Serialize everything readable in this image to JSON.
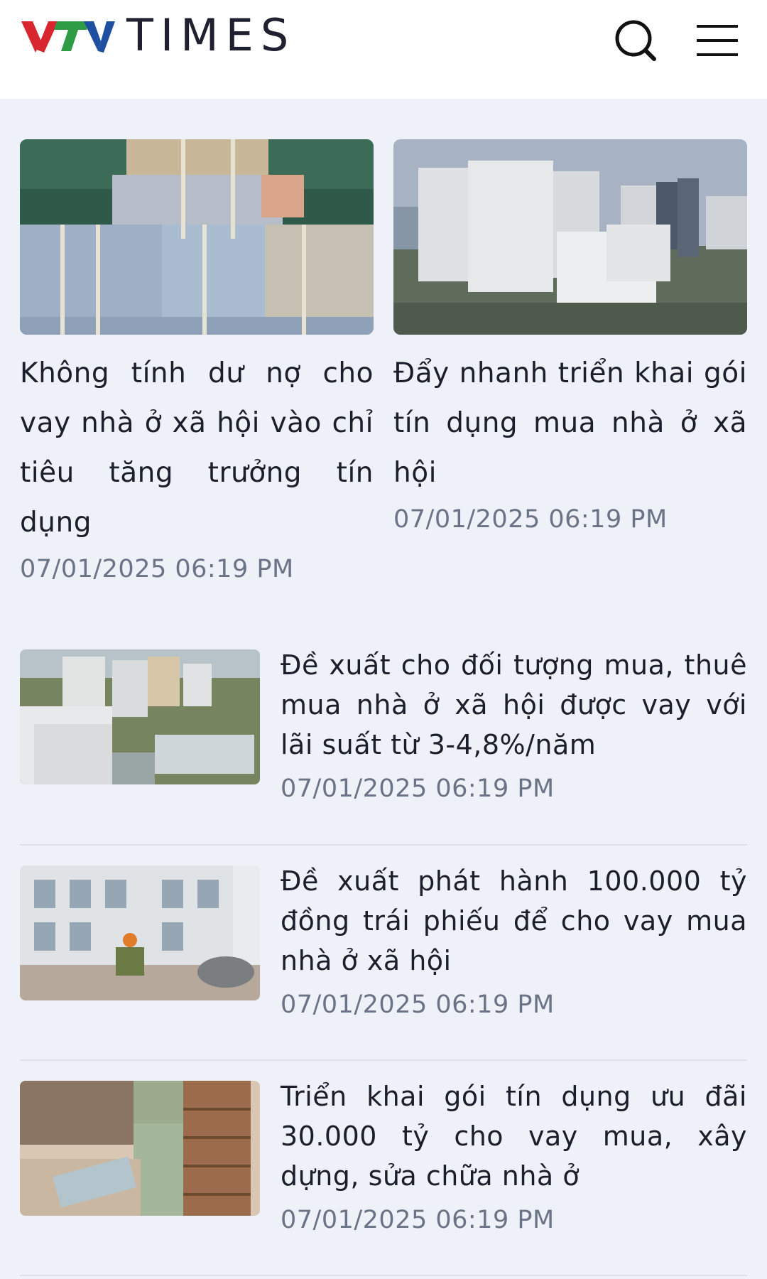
{
  "header": {
    "logo_text": "TIMES",
    "logo_brand": "VTV",
    "search_icon": "search-icon",
    "menu_icon": "hamburger-menu-icon",
    "brand_colors": {
      "red": "#d8262e",
      "green": "#2e9b47",
      "blue": "#1f4fa0"
    }
  },
  "top_articles": [
    {
      "title": "Không tính dư nợ cho vay nhà ở xã hội vào chỉ tiêu tăng trưởng tín dụng",
      "date": "07/01/2025 06:19 PM"
    },
    {
      "title": "Đẩy nhanh triển khai gói tín dụng mua nhà ở xã hội",
      "date": "07/01/2025 06:19 PM"
    }
  ],
  "list_articles": [
    {
      "title": "Đề xuất cho đối tượng mua, thuê mua nhà ở xã hội được vay với lãi suất từ 3-4,8%/năm",
      "date": "07/01/2025 06:19 PM"
    },
    {
      "title": "Đề xuất phát hành 100.000 tỷ đồng trái phiếu để cho vay mua nhà ở xã hội",
      "date": "07/01/2025 06:19 PM"
    },
    {
      "title": "Triển khai gói tín dụng ưu đãi 30.000 tỷ cho vay mua, xây dựng, sửa chữa nhà ở",
      "date": "07/01/2025 06:19 PM"
    }
  ]
}
